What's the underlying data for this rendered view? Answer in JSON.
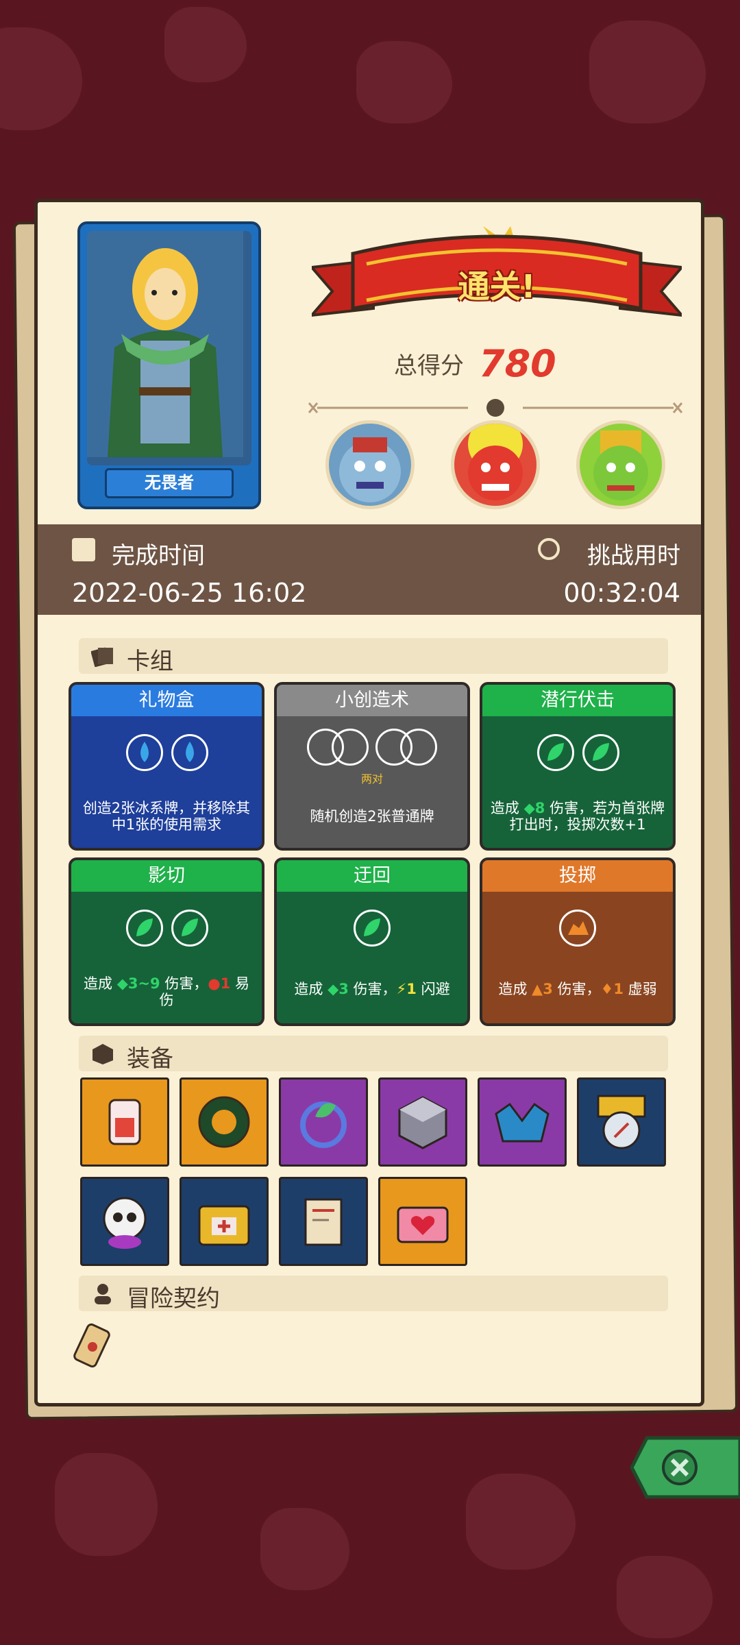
{
  "hero": {
    "name": "无畏者"
  },
  "result": {
    "banner": "通关!",
    "score_label": "总得分",
    "score": "780"
  },
  "info": {
    "finish_label": "完成时间",
    "finish_value": "2022-06-25 16:02",
    "challenge_label": "挑战用时",
    "challenge_value": "00:32:04"
  },
  "deck": {
    "title": "卡组",
    "cards": [
      {
        "title": "礼物盒",
        "desc": "创造2张冰系牌，并移除其中1张的使用需求"
      },
      {
        "title": "小创造术",
        "sub": "两对",
        "desc": "随机创造2张普通牌"
      },
      {
        "title": "潜行伏击",
        "desc_a": "造成",
        "desc_num": "8",
        "desc_b": "伤害，若为首张牌打出时，投掷次数+1"
      },
      {
        "title": "影切",
        "desc_a": "造成",
        "desc_num": "3~9",
        "desc_b": "伤害，",
        "desc_num2": "1",
        "desc_c": "易伤"
      },
      {
        "title": "迂回",
        "desc_a": "造成",
        "desc_num": "3",
        "desc_b": "伤害，",
        "desc_num2": "1",
        "desc_c": "闪避"
      },
      {
        "title": "投掷",
        "desc_a": "造成",
        "desc_num": "3",
        "desc_b": "伤害，",
        "desc_num2": "1",
        "desc_c": "虚弱"
      }
    ]
  },
  "equipment": {
    "title": "装备",
    "items": [
      "jar-icon",
      "ring-icon",
      "leaf-ring-icon",
      "cube-icon",
      "crystal-helm-icon",
      "compass-icon",
      "skull-icon",
      "treasure-chest-icon",
      "scroll-icon",
      "heart-chest-icon"
    ]
  },
  "contract": {
    "title": "冒险契约"
  },
  "colors": {
    "accent": "#e23a2e",
    "panel": "#fbf1d6",
    "band": "#6e5444"
  }
}
